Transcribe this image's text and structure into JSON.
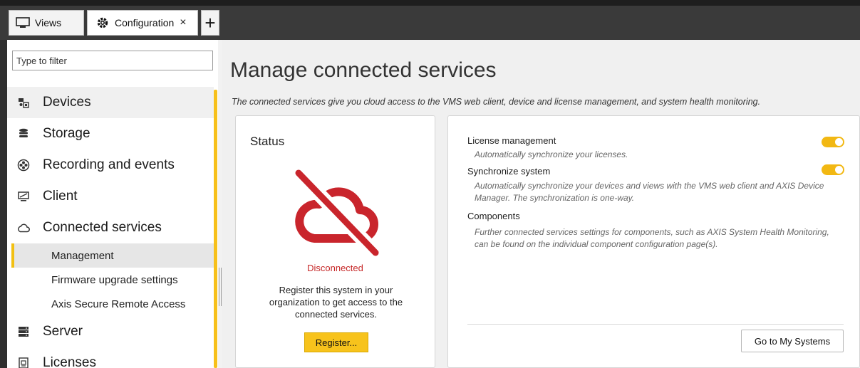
{
  "tabs": {
    "views_label": "Views",
    "configuration_label": "Configuration",
    "close_glyph": "×",
    "add_glyph": "+"
  },
  "sidebar": {
    "filter_placeholder": "Type to filter",
    "items": [
      {
        "label": "Devices",
        "icon": "devices-icon"
      },
      {
        "label": "Storage",
        "icon": "storage-icon"
      },
      {
        "label": "Recording and events",
        "icon": "recording-icon"
      },
      {
        "label": "Client",
        "icon": "client-icon"
      },
      {
        "label": "Connected services",
        "icon": "cloud-icon"
      }
    ],
    "subitems": [
      {
        "label": "Management",
        "active": true
      },
      {
        "label": "Firmware upgrade settings",
        "active": false
      },
      {
        "label": "Axis Secure Remote Access",
        "active": false
      }
    ],
    "items_after": [
      {
        "label": "Server",
        "icon": "server-icon"
      },
      {
        "label": "Licenses",
        "icon": "licenses-icon"
      }
    ]
  },
  "main": {
    "title": "Manage connected services",
    "description": "The connected services give you cloud access to the VMS web client, device and license management, and system health monitoring.",
    "status": {
      "title": "Status",
      "state": "Disconnected",
      "register_text": "Register this system in your organization to get access to the connected services.",
      "register_button": "Register..."
    },
    "settings": {
      "license_label": "License management",
      "license_desc": "Automatically synchronize your licenses.",
      "license_enabled": true,
      "sync_label": "Synchronize system",
      "sync_desc": "Automatically synchronize your devices and views with the VMS web client and AXIS Device Manager. The synchronization is one-way.",
      "sync_enabled": true,
      "components_label": "Components",
      "components_desc": "Further connected services settings for components, such as AXIS System Health Monitoring, can be found on the individual component configuration page(s).",
      "goto_button": "Go to My Systems"
    }
  },
  "colors": {
    "accent": "#f7c31c",
    "error": "#c62828",
    "toggle_on": "#f2b813"
  }
}
